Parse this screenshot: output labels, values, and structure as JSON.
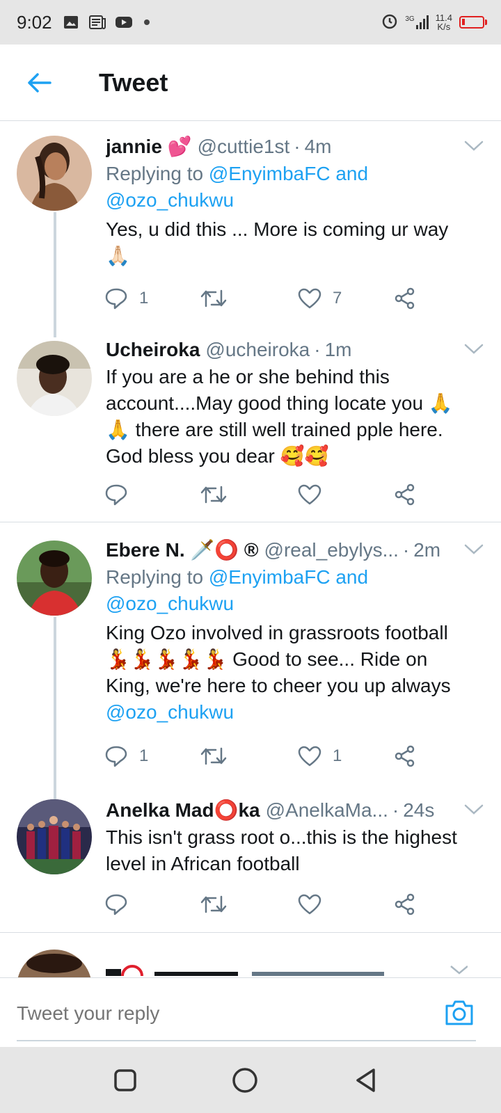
{
  "status_bar": {
    "time": "9:02",
    "network": "3G",
    "speed_value": "11.4",
    "speed_unit": "K/s"
  },
  "header": {
    "title": "Tweet"
  },
  "tweets": [
    {
      "name": "jannie 💕",
      "handle": "@cuttie1st",
      "time": "4m",
      "replying_prefix": "Replying to ",
      "replying_first": "@EnyimbaFC",
      "replying_and": " and",
      "replying_second": "@ozo_chukwu",
      "text": "Yes,  u did this ... More is coming ur way 🙏🏻",
      "reply_count": "1",
      "retweet_count": "",
      "like_count": "7"
    },
    {
      "name": "Ucheiroka",
      "handle": "@ucheiroka",
      "time": "1m",
      "text": "If you are a he or she behind this account....May good thing locate you 🙏🙏 there are still well trained pple here. God bless you dear 🥰🥰",
      "reply_count": "",
      "retweet_count": "",
      "like_count": ""
    },
    {
      "name": "Ebere N. 🗡️⭕ ®",
      "handle": "@real_ebylys...",
      "time": "2m",
      "replying_prefix": "Replying to ",
      "replying_first": "@EnyimbaFC",
      "replying_and": " and",
      "replying_second": "@ozo_chukwu",
      "text": "King Ozo involved in grassroots football 💃💃💃💃💃 Good to see... Ride on King, we're here to cheer you up always ",
      "text_mention": "@ozo_chukwu",
      "reply_count": "1",
      "retweet_count": "",
      "like_count": "1"
    },
    {
      "name": "Anelka Mad⭕ka",
      "handle": "@AnelkaMa...",
      "time": "24s",
      "text": "This isn't grass root o...this is the highest level in African football",
      "reply_count": "",
      "retweet_count": "",
      "like_count": ""
    }
  ],
  "reply_bar": {
    "placeholder": "Tweet your reply"
  },
  "colors": {
    "accent": "#1da1f2",
    "secondary_text": "#657786",
    "divider": "#d8dde2",
    "battery": "#e02020"
  }
}
